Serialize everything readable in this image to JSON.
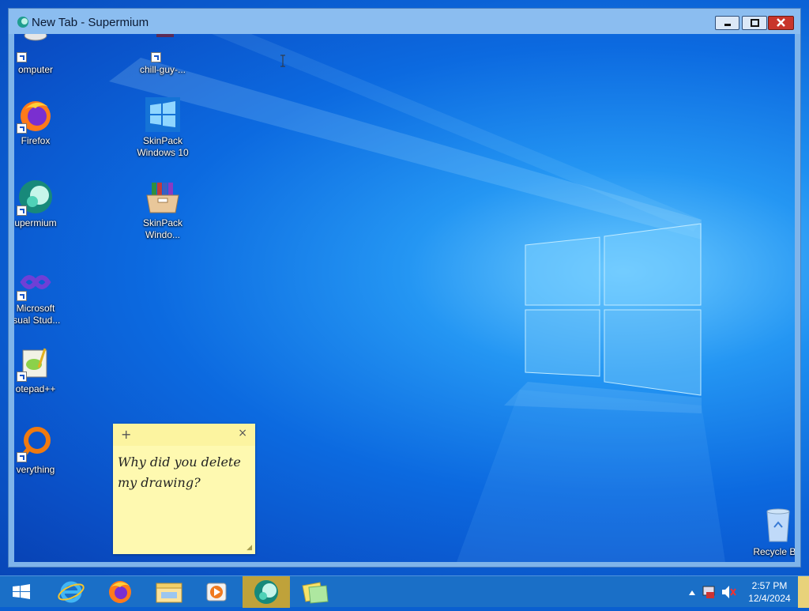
{
  "window": {
    "title": "New Tab - Supermium",
    "controls": {
      "minimize": "minimize",
      "maximize": "maximize",
      "close": "close"
    }
  },
  "desktop": {
    "left_column": [
      {
        "label": "omputer",
        "icon": "computer-icon"
      },
      {
        "label": "Firefox",
        "icon": "firefox-icon"
      },
      {
        "label": "upermium",
        "icon": "supermium-icon"
      },
      {
        "label": "Microsoft\nisual Stud...",
        "icon": "visual-studio-icon"
      },
      {
        "label": "otepad++",
        "icon": "notepad-plus-plus-icon"
      },
      {
        "label": "verything",
        "icon": "everything-search-icon"
      }
    ],
    "second_column": [
      {
        "label": "chill-guy-...",
        "icon": "chill-guy-shortcut-icon"
      },
      {
        "label": "SkinPack\nWindows 10",
        "icon": "windows-logo-icon"
      },
      {
        "label": "SkinPack\nWindo...",
        "icon": "skinpack-box-icon"
      }
    ],
    "recycle_bin": {
      "label": "Recycle Bin",
      "icon": "recycle-bin-icon"
    }
  },
  "sticky_note": {
    "line1": "Why did you delete",
    "line2": "my drawing?",
    "add_glyph": "+",
    "close_glyph": "×"
  },
  "taskbar": {
    "items": [
      {
        "name": "start-button",
        "icon": "windows-start-icon"
      },
      {
        "name": "internet-explorer",
        "icon": "internet-explorer-icon"
      },
      {
        "name": "firefox",
        "icon": "firefox-icon"
      },
      {
        "name": "file-explorer",
        "icon": "folder-icon"
      },
      {
        "name": "media-player",
        "icon": "media-player-icon"
      },
      {
        "name": "supermium",
        "icon": "supermium-icon",
        "active": true
      },
      {
        "name": "sticky-notes",
        "icon": "sticky-notes-icon"
      }
    ],
    "clock_time": "2:57 PM",
    "clock_date": "12/4/2024"
  },
  "colors": {
    "accent": "#1a6fc7",
    "active_taskbar": "#bfa23a",
    "note": "#fef9b0",
    "close_button": "#c8352a"
  }
}
